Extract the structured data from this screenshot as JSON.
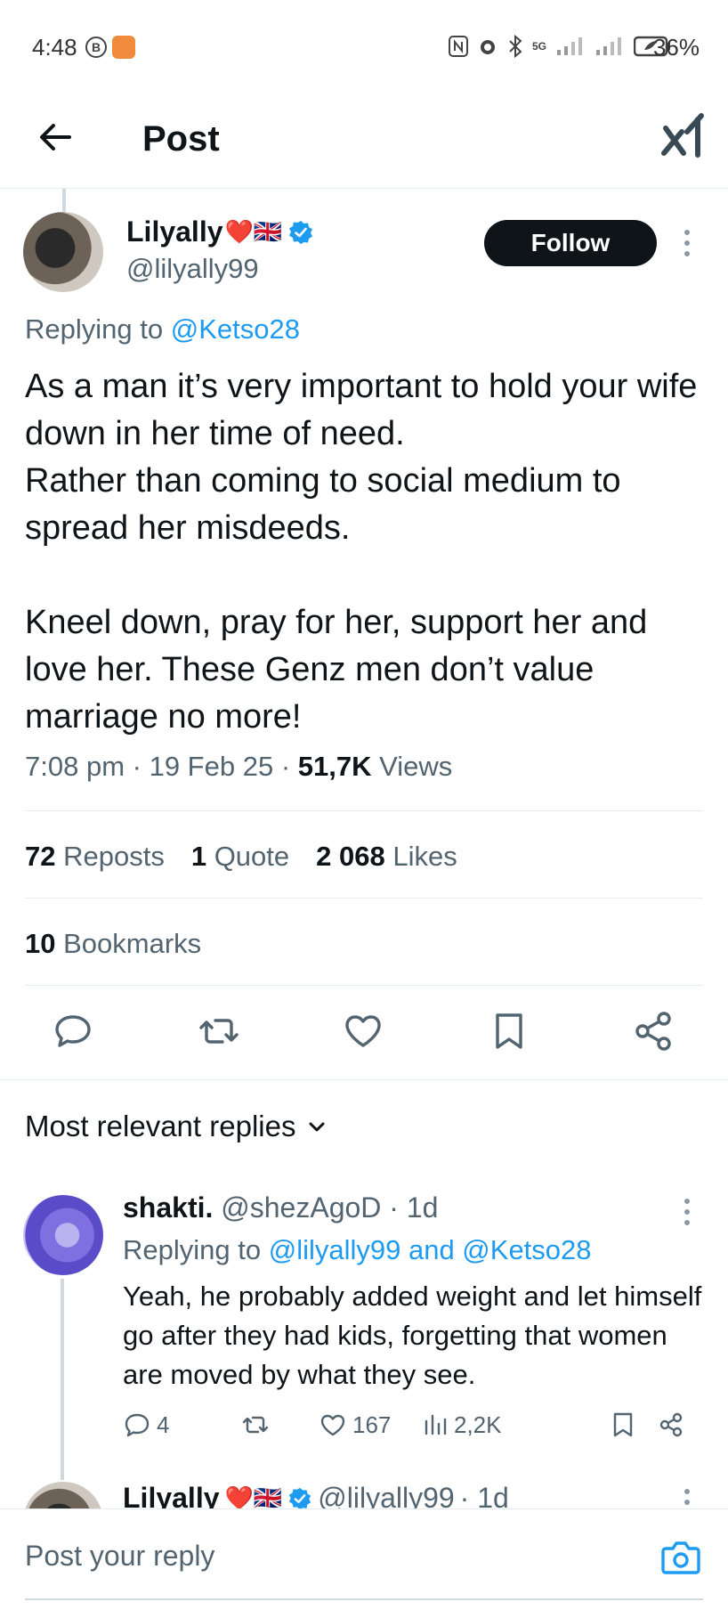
{
  "status_bar": {
    "time": "4:48",
    "b_badge": "B",
    "network": "5G",
    "battery": "36%"
  },
  "header": {
    "title": "Post",
    "logo": "x-logo"
  },
  "post": {
    "display_name": "Lilyally",
    "name_emoji": "❤️🇬🇧",
    "handle": "@lilyally99",
    "follow_label": "Follow",
    "replying_prefix": "Replying to ",
    "replying_to": "@Ketso28",
    "text": "As a man it’s very important to hold your wife down in her time of need.\nRather than coming to social medium to spread her misdeeds.\n\nKneel down, pray for her, support her and love her.  These Genz men don’t value marriage no more!",
    "time": "7:08 pm",
    "date": "19 Feb 25",
    "views_count": "51,7K",
    "views_label": " Views",
    "reposts_count": "72",
    "reposts_label": " Reposts",
    "quotes_count": "1",
    "quotes_label": " Quote",
    "likes_count": "2 068",
    "likes_label": " Likes",
    "bookmarks_count": "10",
    "bookmarks_label": " Bookmarks"
  },
  "replies_sort": {
    "label": "Most relevant replies"
  },
  "reply": {
    "display_name": "shakti.",
    "handle": "@shezAgoD",
    "age": "· 1d",
    "replying_prefix": "Replying to ",
    "replying_to": "@lilyally99 and @Ketso28",
    "text": "Yeah, he probably added weight and let himself go after they had kids, forgetting that women are moved by what they see.",
    "reply_count": "4",
    "like_count": "167",
    "view_count": "2,2K"
  },
  "next_reply": {
    "display_name": "Lilyally",
    "name_emoji": "❤️🇬🇧",
    "handle": "@lilyally99",
    "age": "· 1d"
  },
  "composer": {
    "placeholder": "Post your reply"
  },
  "colors": {
    "accent": "#1d9bf0",
    "text": "#0f1419",
    "muted": "#536471",
    "follow_bg": "#0f1419"
  }
}
